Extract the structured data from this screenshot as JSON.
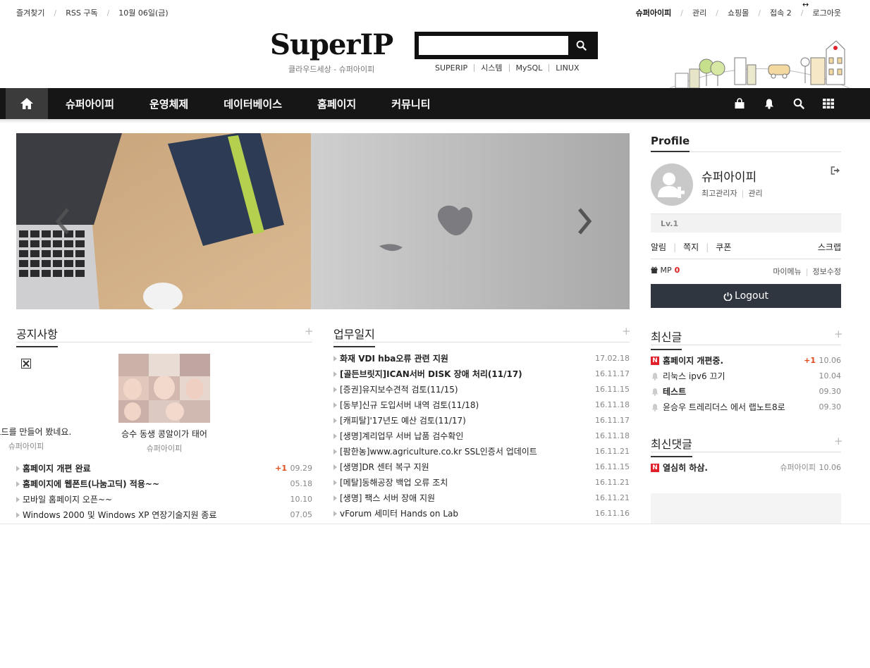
{
  "topbar": {
    "left": [
      "즐겨찾기",
      "RSS 구독",
      "10월 06일(금)"
    ],
    "user": "슈퍼아이피",
    "admin": "관리",
    "shop": "쇼핑몰",
    "visitors": "접속 2",
    "logout": "로그아웃"
  },
  "header": {
    "logo": "SuperIP",
    "slogan": "클라우드세상 - 슈퍼아이피",
    "search_value": "",
    "search_tags": [
      "SUPERIP",
      "시스템",
      "MySQL",
      "LINUX"
    ]
  },
  "nav": {
    "items": [
      "슈퍼아이피",
      "운영체제",
      "데이터베이스",
      "홈페이지",
      "커뮤니티"
    ]
  },
  "notice": {
    "title": "공지사항",
    "gallery": [
      {
        "caption": "QR코드를 만들어 봤네요.",
        "author": "슈퍼아이피"
      },
      {
        "caption": "승수 동생 콩알이가 태어",
        "author": "슈퍼아이피"
      }
    ],
    "items": [
      {
        "title": "홈페이지 개편 완료",
        "count": "+1",
        "date": "09.29",
        "bold": true
      },
      {
        "title": "홈페이지에 웹폰트(나눔고딕) 적용~~",
        "count": "",
        "date": "05.18",
        "bold": true
      },
      {
        "title": "모바일 홈페이지 오픈~~",
        "count": "",
        "date": "10.10",
        "bold": false
      },
      {
        "title": "Windows 2000 및 Windows XP 연장기술지원 종료",
        "count": "",
        "date": "07.05",
        "bold": false
      }
    ]
  },
  "worklog": {
    "title": "업무일지",
    "items": [
      {
        "title": "화재 VDI hba오류 관련 지원",
        "date": "17.02.18",
        "bold": true
      },
      {
        "title": "[골든브릿지]ICAN서버 DISK 장애 처리(11/17)",
        "date": "16.11.17",
        "bold": true
      },
      {
        "title": "[증권]유지보수견적 검토(11/15)",
        "date": "16.11.15",
        "bold": false
      },
      {
        "title": "[동부]신규 도입서버 내역 검토(11/18)",
        "date": "16.11.18",
        "bold": false
      },
      {
        "title": "[캐피탈]'17년도 예산 검토(11/17)",
        "date": "16.11.17",
        "bold": false
      },
      {
        "title": "[생명]계리업무 서버 납품 검수확인",
        "date": "16.11.18",
        "bold": false
      },
      {
        "title": "[팜한농]www.agriculture.co.kr SSL인증서 업데이트",
        "date": "16.11.21",
        "bold": false
      },
      {
        "title": "[생명]DR 센터 복구 지원",
        "date": "16.11.15",
        "bold": false
      },
      {
        "title": "[메탈]동해공장 백업 오류 조치",
        "date": "16.11.21",
        "bold": false
      },
      {
        "title": "[생명] 팩스 서버 장애 지원",
        "date": "16.11.21",
        "bold": false
      },
      {
        "title": "vForum 세미터 Hands on Lab",
        "date": "16.11.16",
        "bold": false
      }
    ]
  },
  "profile": {
    "title": "Profile",
    "name": "슈퍼아이피",
    "role": "최고관리자",
    "manage": "관리",
    "level": "Lv.1",
    "links": [
      "알림",
      "쪽지",
      "쿠폰"
    ],
    "scrap": "스크랩",
    "mp_label": "MP",
    "mp_value": "0",
    "mymenu": "마이메뉴",
    "edit": "정보수정",
    "logout": "Logout"
  },
  "recent_posts": {
    "title": "최신글",
    "items": [
      {
        "title": "홈페이지 개편중.",
        "count": "+1",
        "date": "10.06",
        "new": true
      },
      {
        "title": "리눅스 ipv6 끄기",
        "count": "",
        "date": "10.04",
        "new": false
      },
      {
        "title": "테스트",
        "count": "",
        "date": "09.30",
        "new": false
      },
      {
        "title": "윤승우 트레리더스 에서 랩노트8로",
        "count": "",
        "date": "09.30",
        "new": false
      }
    ]
  },
  "recent_comments": {
    "title": "최신댓글",
    "items": [
      {
        "title": "열심히 하삼.",
        "author": "슈퍼아이피",
        "date": "10.06",
        "new": true
      }
    ]
  },
  "colors": {
    "nav_bg": "#161616",
    "accent_red": "#e0202a",
    "logout_bg": "#2f3640"
  }
}
